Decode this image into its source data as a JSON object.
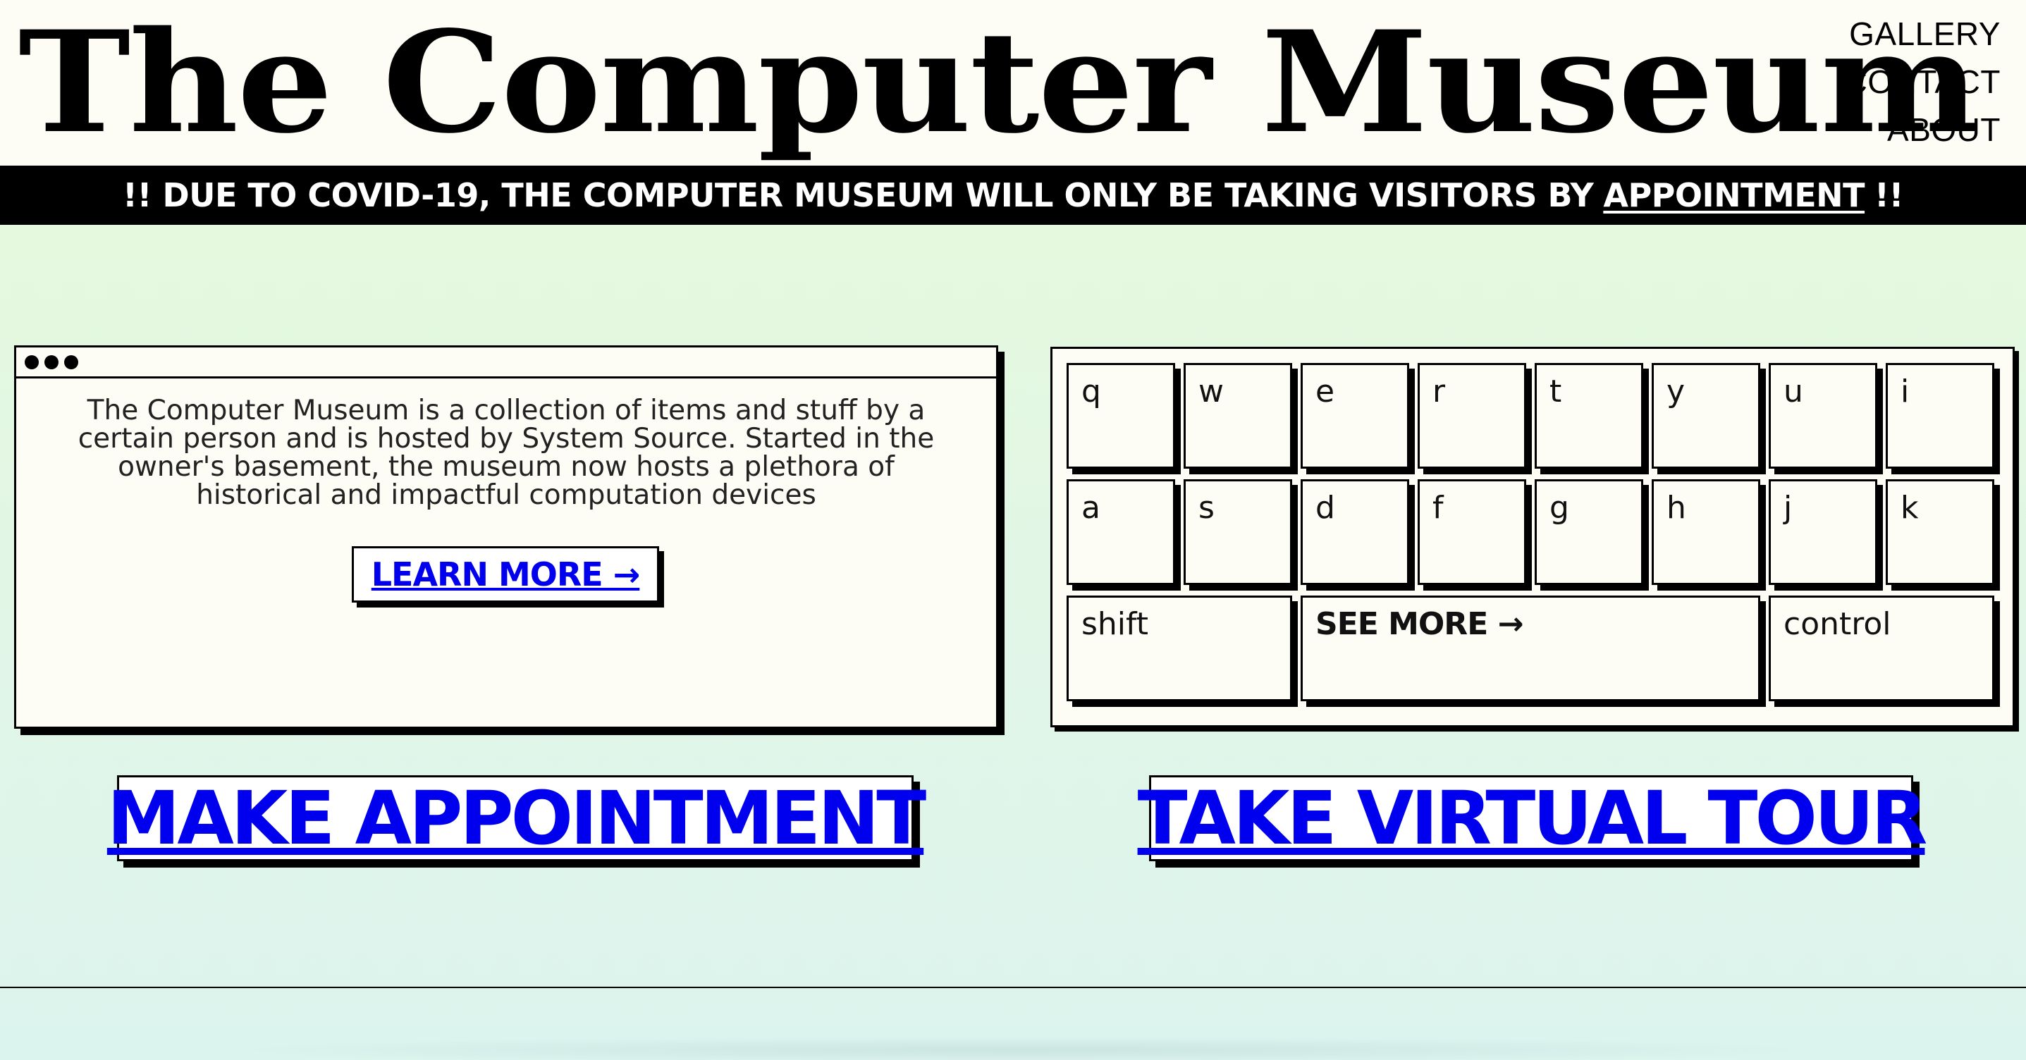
{
  "header": {
    "title": "The Computer Museum",
    "nav": [
      "GALLERY",
      "CONTACT",
      "ABOUT"
    ]
  },
  "banner": {
    "prefix": "!! DUE TO COVID-19, THE COMPUTER MUSEUM WILL ONLY BE TAKING VISITORS BY",
    "link": "APPOINTMENT",
    "suffix": "!!"
  },
  "about_window": {
    "text": "The Computer Museum is a collection of items and stuff by a certain person and is hosted by System Source. Started in the owner's basement, the museum now hosts a plethora of historical and impactful computation devices",
    "button": "LEARN MORE →"
  },
  "keyboard": {
    "row1": [
      "q",
      "w",
      "e",
      "r",
      "t",
      "y",
      "u",
      "i"
    ],
    "row2": [
      "a",
      "s",
      "d",
      "f",
      "g",
      "h",
      "j",
      "k"
    ],
    "shift": "shift",
    "see_more": "SEE MORE →",
    "control": "control"
  },
  "actions": {
    "appointment": "MAKE APPOINTMENT",
    "tour": "TAKE VIRTUAL TOUR"
  },
  "colors": {
    "background_top": "#e6fbd9",
    "background_bottom": "#dcf4ee",
    "panel": "#fdfdf5",
    "ink": "#000000"
  }
}
